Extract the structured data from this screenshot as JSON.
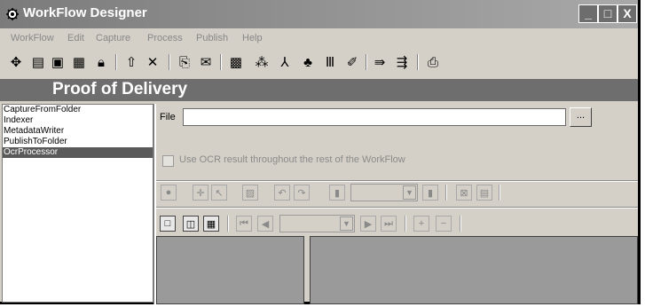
{
  "window": {
    "title": "WorkFlow Designer",
    "minimize": "_",
    "maximize": "□",
    "close": "X"
  },
  "menu": [
    "WorkFlow",
    "Edit",
    "Capture",
    "Process",
    "Publish",
    "Help"
  ],
  "banner": {
    "title": "Proof of Delivery"
  },
  "steps": {
    "items": [
      "CaptureFromFolder",
      "Indexer",
      "MetadataWriter",
      "PublishToFolder",
      "OcrProcessor"
    ],
    "selected_index": 4
  },
  "file": {
    "label": "File",
    "value": "",
    "browse_label": "..."
  },
  "ocr_option": {
    "label": "Use OCR result throughout the rest of the WorkFlow",
    "checked": false
  },
  "toolbar_icons": [
    "new-workflow-icon",
    "open-icon",
    "save-icon",
    "save-as-icon",
    "lock-icon",
    "up-arrow-icon",
    "delete-icon",
    "capture-icon",
    "email-icon",
    "scan-icon",
    "ocr-icon",
    "pdf-icon",
    "meta-icon",
    "barcode-icon",
    "stamp-icon",
    "publish-icon",
    "publish-folder-icon",
    "preview-icon"
  ]
}
